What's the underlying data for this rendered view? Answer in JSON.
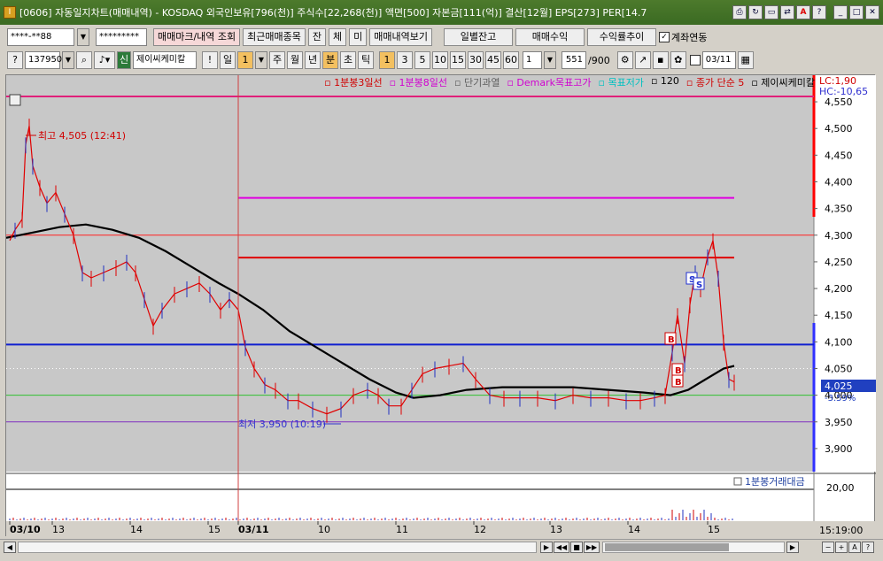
{
  "window": {
    "title": "[0606] 자동일지차트(매매내역) - KOSDAQ 외국인보유[796(천)] 주식수[22,268(천)] 액면[500] 자본금[111(억)] 결산[12월] EPS[273] PER[14.7",
    "app_icon": "I"
  },
  "toolbar1": {
    "account_value": "****-**88",
    "password_value": "*********",
    "trade_mark_btn": "매매마크/내역 조회",
    "recent_trades_btn": "최근매매종목",
    "btn_jan": "잔",
    "btn_che": "체",
    "btn_mi": "미",
    "trade_history_btn": "매매내역보기",
    "daily_balance_btn": "일별잔고",
    "trade_profit_btn": "매매수익",
    "return_trend_btn": "수익률추이",
    "account_link_label": "계좌연동",
    "account_link_checked": "✓"
  },
  "toolbar2": {
    "stock_code": "137950",
    "stock_name": "제이씨케미칼",
    "sin_label": "신",
    "excl": "!",
    "period_day": "일",
    "period_value": "1",
    "periods": [
      "주",
      "월",
      "년"
    ],
    "minute": "분",
    "tick_sec": "초",
    "tick": "틱",
    "intervals": [
      "1",
      "3",
      "5",
      "10",
      "15",
      "30",
      "45",
      "60"
    ],
    "interval_value": "1",
    "count": "551",
    "count_max": "/900",
    "date": "03/11"
  },
  "legend": {
    "items": [
      {
        "text": "1분봉3일선",
        "color": "#d00000"
      },
      {
        "text": "1분봉8일선",
        "color": "#d000d0"
      },
      {
        "text": "단기과열",
        "color": "#606060"
      },
      {
        "text": "Demark목표고가",
        "color": "#d000d0"
      },
      {
        "text": "목표저가",
        "color": "#00c0c0"
      },
      {
        "text": "120",
        "color": "#000000"
      },
      {
        "text": "종가 단순 5",
        "color": "#d00000"
      },
      {
        "text": "제이씨케미칼",
        "color": "#000000"
      }
    ]
  },
  "chart": {
    "lc_label": "LC:1,90",
    "hc_label": "HC:-10,65",
    "high_label": "최고 4,505 (12:41)",
    "low_label": "최저 3,950 (10:19)",
    "current_price": "4,025",
    "current_change": "-3.59%",
    "volume_label": "1분봉거래대금",
    "volume_scale": "20,00",
    "y_ticks": [
      "4,550",
      "4,500",
      "4,450",
      "4,400",
      "4,350",
      "4,300",
      "4,250",
      "4,200",
      "4,150",
      "4,100",
      "4,050",
      "4,000",
      "3,950",
      "3,900"
    ],
    "x_labels": [
      "03/10",
      "13",
      "14",
      "15",
      "03/11",
      "10",
      "11",
      "12",
      "13",
      "14",
      "15"
    ],
    "time_label": "15:19:00",
    "markers": [
      "B",
      "B",
      "B",
      "S",
      "S"
    ]
  },
  "scrollbar": {
    "controls": [
      "▶",
      "◀◀",
      "■",
      "▶▶",
      "−",
      "+",
      "A",
      "?"
    ]
  }
}
